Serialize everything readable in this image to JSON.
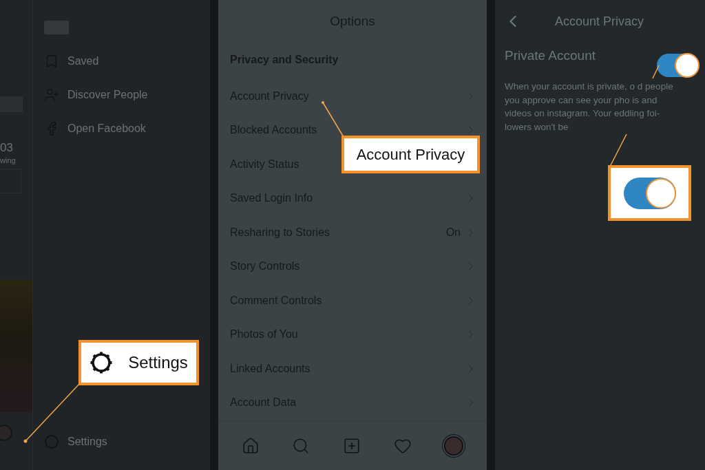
{
  "profile_strip": {
    "count": "03",
    "count_label": "wing"
  },
  "side_menu": {
    "items": [
      {
        "label": "Saved",
        "kind": "bookmark"
      },
      {
        "label": "Discover People",
        "kind": "person"
      },
      {
        "label": "Open Facebook",
        "kind": "facebook"
      }
    ],
    "settings": "Settings"
  },
  "options": {
    "title": "Options",
    "section": "Privacy and Security",
    "rows": [
      {
        "label": "Account Privacy"
      },
      {
        "label": "Blocked Accounts"
      },
      {
        "label": "Activity Status"
      },
      {
        "label": "Saved Login Info"
      },
      {
        "label": "Resharing to Stories",
        "value": "On"
      },
      {
        "label": "Story Controls"
      },
      {
        "label": "Comment Controls"
      },
      {
        "label": "Photos of You"
      },
      {
        "label": "Linked Accounts"
      },
      {
        "label": "Account Data"
      }
    ]
  },
  "privacy": {
    "title": "Account Privacy",
    "setting": "Private Account",
    "on": true,
    "description": "When your account is private, o d people you approve can see your pho is and videos on instagram. Your eddling foi-lowers won't be"
  },
  "callouts": [
    {
      "kind": "icon_label",
      "text": "Settings"
    },
    {
      "kind": "label",
      "text": "Account Privacy"
    },
    {
      "kind": "toggle",
      "on": true
    }
  ]
}
